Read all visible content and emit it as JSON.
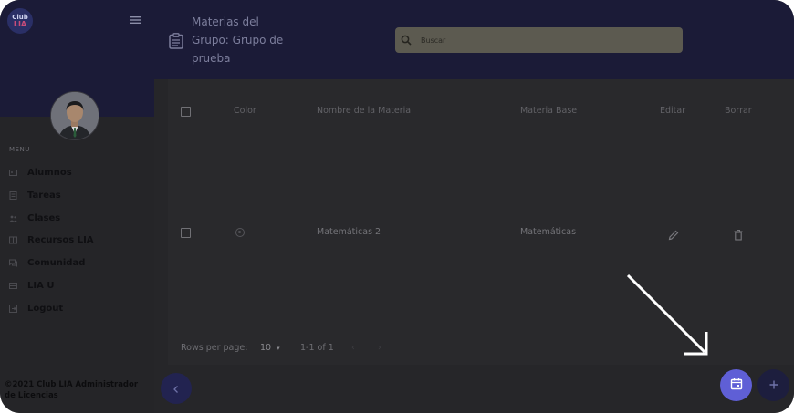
{
  "sidebar": {
    "logo": {
      "line1": "Club",
      "line2": "LIA"
    },
    "menu_label": "MENU",
    "items": [
      {
        "label": "Alumnos",
        "icon": "person-card-icon"
      },
      {
        "label": "Tareas",
        "icon": "tasks-icon"
      },
      {
        "label": "Clases",
        "icon": "group-icon"
      },
      {
        "label": "Recursos LIA",
        "icon": "resources-icon"
      },
      {
        "label": "Comunidad",
        "icon": "forum-icon"
      },
      {
        "label": "LIA U",
        "icon": "school-icon"
      },
      {
        "label": "Logout",
        "icon": "logout-icon"
      }
    ],
    "copyright": "©2021 Club LIA Administrador de Licencias"
  },
  "header": {
    "title": "Materias del Grupo: Grupo de prueba",
    "search_placeholder": "Buscar"
  },
  "table": {
    "columns": {
      "color": "Color",
      "name": "Nombre de la Materia",
      "base": "Materia Base",
      "edit": "Editar",
      "delete": "Borrar"
    },
    "rows": [
      {
        "name": "Matemáticas 2",
        "base": "Matemáticas"
      }
    ],
    "pagination": {
      "rows_per_page_label": "Rows per page:",
      "rows_per_page_value": "10",
      "range": "1-1 of 1"
    }
  },
  "colors": {
    "header_bg": "#1b1b37",
    "content_bg": "#262629",
    "accent": "#5f5fd6"
  }
}
